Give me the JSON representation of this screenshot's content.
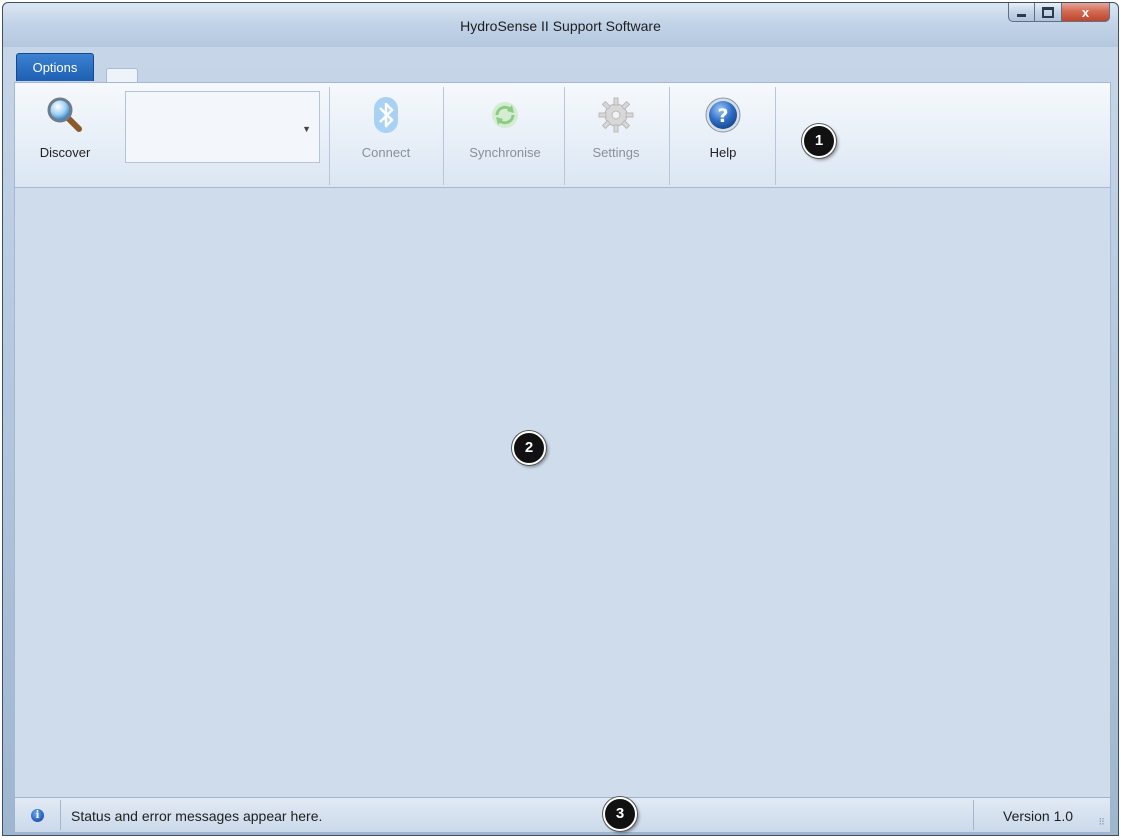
{
  "window": {
    "title": "HydroSense II Support Software",
    "controls": {
      "minimize": "minimize-icon",
      "maximize": "maximize-icon",
      "close": "x"
    }
  },
  "ribbon": {
    "tab_label": "Options",
    "buttons": {
      "discover": {
        "label": "Discover",
        "icon": "magnifier-icon",
        "enabled": true
      },
      "connect": {
        "label": "Connect",
        "icon": "bluetooth-icon",
        "enabled": false
      },
      "synchronise": {
        "label": "Synchronise",
        "icon": "sync-icon",
        "enabled": false
      },
      "settings": {
        "label": "Settings",
        "icon": "gear-icon",
        "enabled": false
      },
      "help": {
        "label": "Help",
        "icon": "help-icon",
        "enabled": true
      }
    },
    "device_dropdown": {
      "value": ""
    }
  },
  "callouts": {
    "one": "1",
    "two": "2",
    "three": "3"
  },
  "statusbar": {
    "icon": "i",
    "message": "Status and error messages appear here.",
    "version": "Version 1.0"
  },
  "colors": {
    "tab_blue": "#1e5fb3",
    "content_bg": "#cfdcec",
    "close_red": "#c1442b"
  }
}
